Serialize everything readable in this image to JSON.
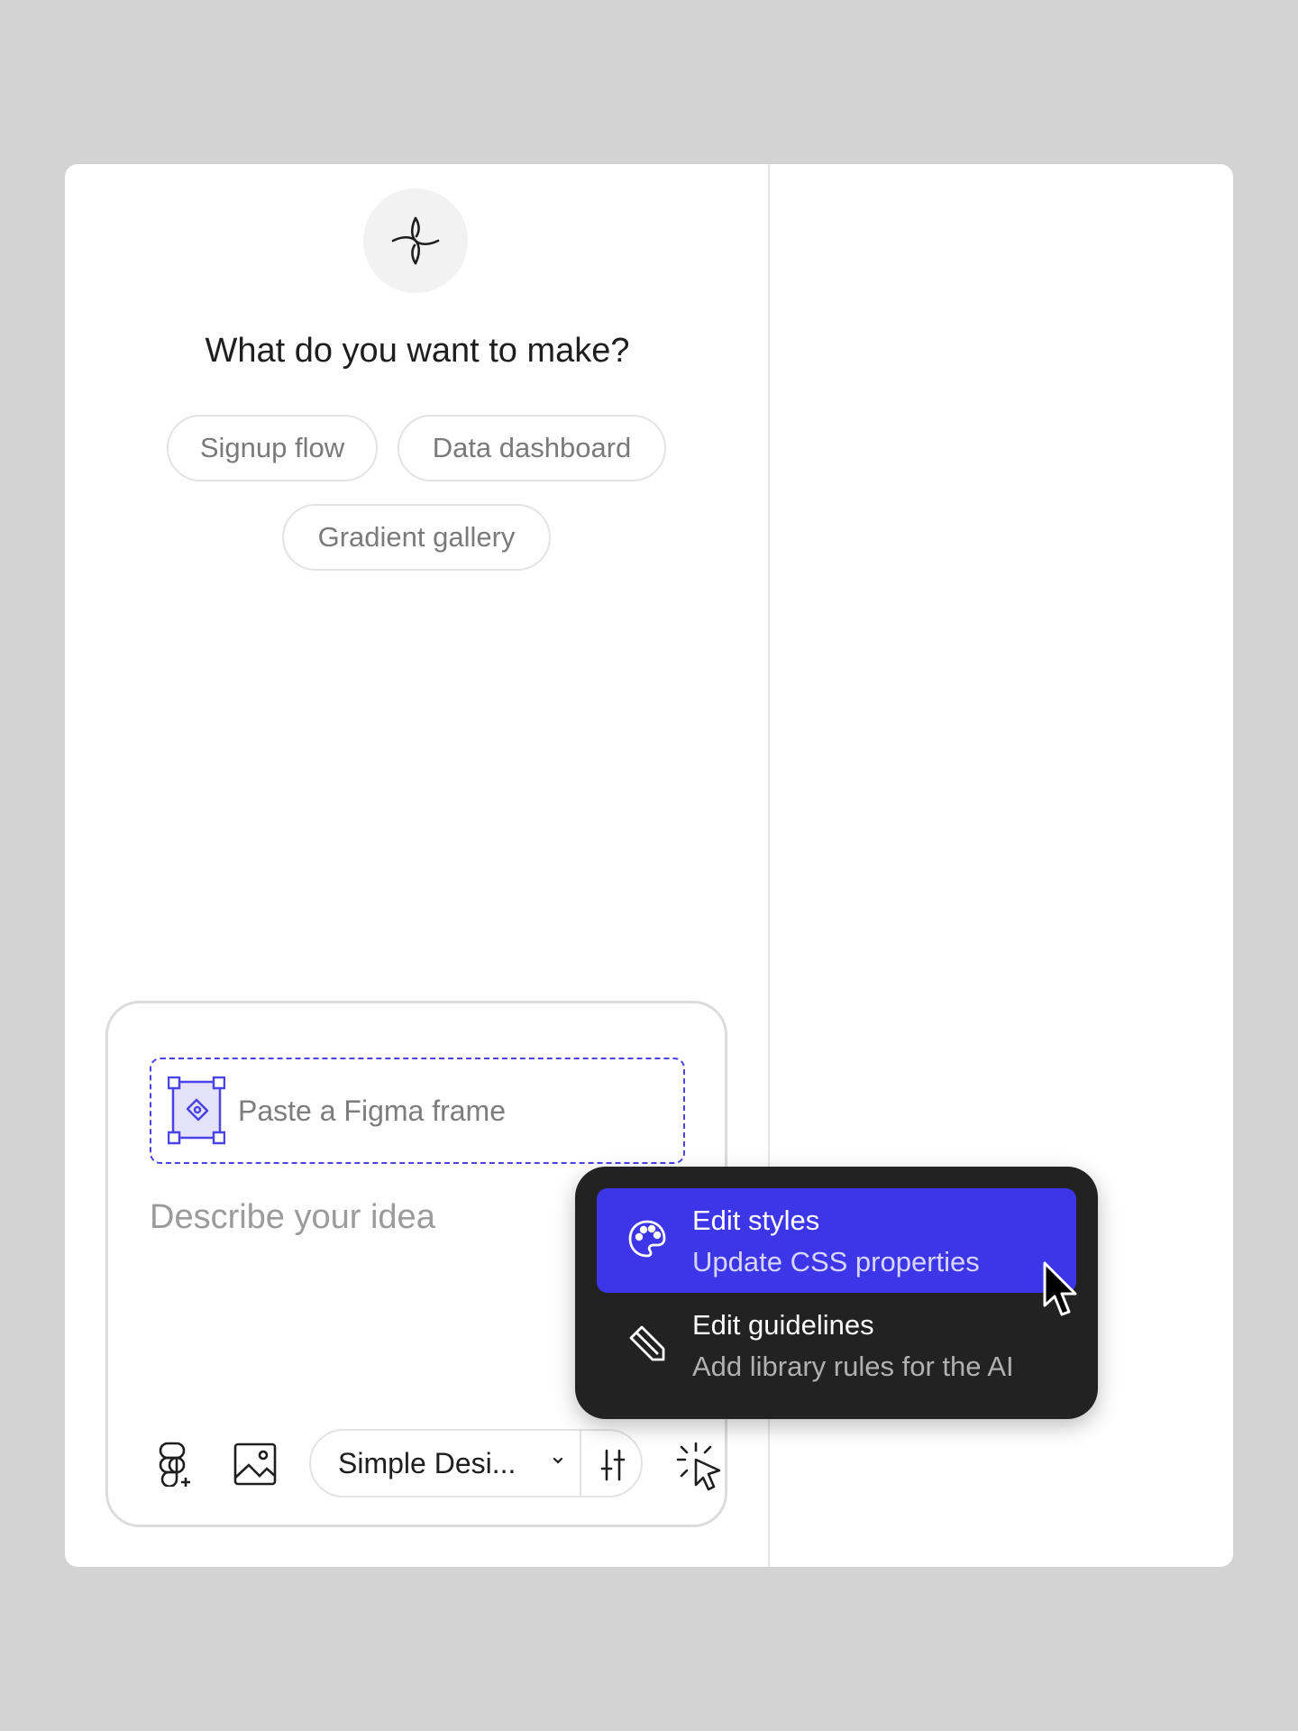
{
  "heading": "What do you want to make?",
  "suggestions": [
    "Signup flow",
    "Data dashboard",
    "Gradient gallery"
  ],
  "composer": {
    "figma_placeholder": "Paste a Figma frame",
    "idea_placeholder": "Describe your idea",
    "library_select": "Simple Desi...",
    "icons": {
      "figma": "figma-plus-icon",
      "image": "image-icon",
      "chevron": "chevron-down-icon",
      "settings": "sliders-icon",
      "select": "cursor-select-icon"
    }
  },
  "menu": {
    "items": [
      {
        "title": "Edit styles",
        "subtitle": "Update CSS properties",
        "icon": "palette-icon"
      },
      {
        "title": "Edit guidelines",
        "subtitle": "Add library rules for the AI",
        "icon": "pencil-icon"
      }
    ]
  },
  "colors": {
    "accent": "#3d36e8",
    "background": "#d3d3d3",
    "menu_bg": "#222222"
  }
}
